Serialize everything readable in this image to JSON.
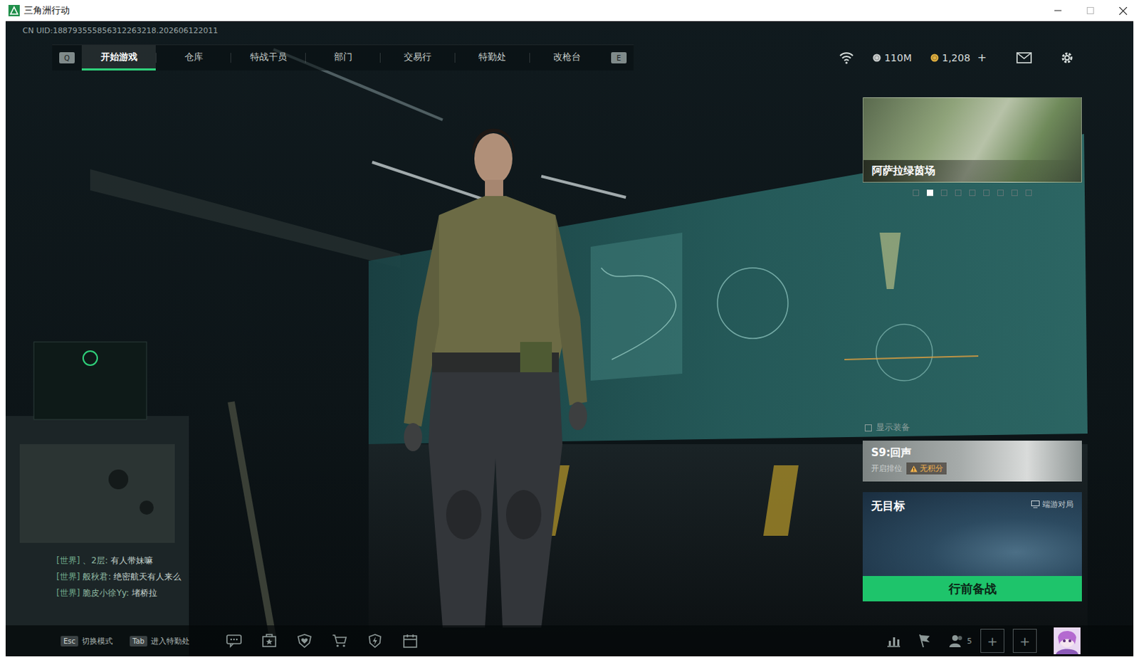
{
  "window": {
    "title": "三角洲行动"
  },
  "uid": "CN UID:188793555856312263218.202606122011",
  "nav": {
    "prev_key": "Q",
    "next_key": "E",
    "tabs": [
      {
        "label": "开始游戏",
        "selected": true
      },
      {
        "label": "仓库",
        "selected": false
      },
      {
        "label": "特战干员",
        "selected": false
      },
      {
        "label": "部门",
        "selected": false
      },
      {
        "label": "交易行",
        "selected": false
      },
      {
        "label": "特勤处",
        "selected": false
      },
      {
        "label": "改枪台",
        "selected": false
      }
    ]
  },
  "currencies": [
    {
      "amount": "110M",
      "color": "#c9cdcc"
    },
    {
      "amount": "1,208",
      "color": "#e0b040"
    }
  ],
  "add_currency": "+",
  "event_banner": {
    "title": "阿萨拉绿茵场",
    "dots": [
      {
        "selected": false
      },
      {
        "selected": true
      },
      {
        "selected": false
      },
      {
        "selected": false
      },
      {
        "selected": false
      },
      {
        "selected": false
      },
      {
        "selected": false
      },
      {
        "selected": false
      },
      {
        "selected": false
      }
    ]
  },
  "show_gear": {
    "label": "显示装备",
    "checked": false
  },
  "season": {
    "title": "S9:回声",
    "subtitle": "开启排位",
    "badge": "无积分"
  },
  "mode": {
    "title": "无目标",
    "platform": "端游对局",
    "button": "行前备战"
  },
  "chat": [
    {
      "channel": "[世界]",
      "name": "、2层:",
      "message": "有人带妹嘛"
    },
    {
      "channel": "[世界]",
      "name": "般秋君:",
      "message": "绝密航天有人来么"
    },
    {
      "channel": "[世界]",
      "name": "脆皮小徐Yy:",
      "message": "堵桥拉"
    }
  ],
  "bottom_bar": {
    "hints": [
      {
        "key": "Esc",
        "label": "切换模式"
      },
      {
        "key": "Tab",
        "label": "进入特勤处"
      }
    ],
    "friends_online": "5",
    "team_slots": [
      {
        "label": "+"
      },
      {
        "label": "+"
      }
    ]
  }
}
